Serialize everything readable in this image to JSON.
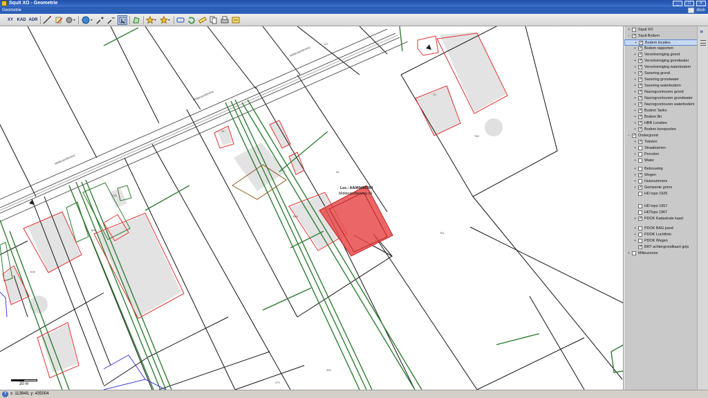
{
  "window": {
    "title": "Squit XO - Geometrie"
  },
  "menu": {
    "items": [
      "Geometrie"
    ],
    "dock_label": "dock"
  },
  "toolbar": {
    "xy_label": "XY",
    "kad_label": "KAD",
    "adr_label": "ADR"
  },
  "map": {
    "labels": {
      "street_top": "Middenpolderweg",
      "street_mid": "Middenpolderweg",
      "street_low": "Middenpolderweg",
      "p147": "147",
      "p760": "760",
      "p761": "761",
      "p805": "805",
      "p715": "715",
      "p618": "618",
      "p889": "889",
      "p400": "400",
      "p479": "479",
      "p70": "70",
      "p10": "10",
      "p25": "25"
    },
    "marker": {
      "loc": "Loc.: AA069400264",
      "address": "Middenpolderweg 29"
    },
    "scale_label": "20 m"
  },
  "status": {
    "coords": "x: 113949, y: 435004"
  },
  "layers": [
    {
      "label": "Squit XO",
      "level": 0,
      "exp": "+",
      "check": false
    },
    {
      "label": "Squit Bodem",
      "level": 0,
      "exp": "−",
      "check": true
    },
    {
      "label": "Bodem locaties",
      "level": 1,
      "exp": "+",
      "check": true,
      "selected": true
    },
    {
      "label": "Bodem rapporten",
      "level": 1,
      "exp": "+",
      "check": true
    },
    {
      "label": "Verontreiniging grond",
      "level": 1,
      "exp": "+",
      "check": true
    },
    {
      "label": "Verontreiniging grondwater",
      "level": 1,
      "exp": "+",
      "check": true
    },
    {
      "label": "Verontreiniging waterbodem",
      "level": 1,
      "exp": "+",
      "check": true
    },
    {
      "label": "Sanering grond",
      "level": 1,
      "exp": "+",
      "check": true
    },
    {
      "label": "Sanering grondwater",
      "level": 1,
      "exp": "+",
      "check": true
    },
    {
      "label": "Sanering waterbodem",
      "level": 1,
      "exp": "+",
      "check": true
    },
    {
      "label": "Nazorgcontouren grond",
      "level": 1,
      "exp": "+",
      "check": true
    },
    {
      "label": "Nazorgcontouren grondwater",
      "level": 1,
      "exp": "+",
      "check": true
    },
    {
      "label": "Nazorgcontouren waterbodem",
      "level": 1,
      "exp": "+",
      "check": true
    },
    {
      "label": "Bodem Tanks",
      "level": 1,
      "exp": "+",
      "check": true
    },
    {
      "label": "Bodem Bri",
      "level": 1,
      "exp": "+",
      "check": true
    },
    {
      "label": "HBB Locaties",
      "level": 1,
      "exp": "+",
      "check": true
    },
    {
      "label": "Bodem boorpunten",
      "level": 1,
      "exp": "+",
      "check": true
    },
    {
      "label": "Ondergrond",
      "level": 0,
      "exp": "−",
      "check": true
    },
    {
      "label": "Teksten",
      "level": 1,
      "exp": "+",
      "check": true
    },
    {
      "label": "Straatnamen",
      "level": 1,
      "exp": "+",
      "check": false
    },
    {
      "label": "Percelen",
      "level": 1,
      "exp": "+",
      "check": false
    },
    {
      "label": "Water",
      "level": 1,
      "exp": "+",
      "check": false
    },
    {
      "label": "Bebouwing",
      "level": 1,
      "exp": "+",
      "check": false
    },
    {
      "label": "Wegen",
      "level": 1,
      "exp": "+",
      "check": true
    },
    {
      "label": "Huisnummers",
      "level": 1,
      "exp": "+",
      "check": false
    },
    {
      "label": "Gemeente grens",
      "level": 1,
      "exp": "+",
      "check": true
    },
    {
      "label": "HD topo 1925",
      "level": 1,
      "exp": "",
      "check": false
    },
    {
      "label": "HD topo 1957",
      "level": 1,
      "exp": "",
      "check": false
    },
    {
      "label": "HDTopo 1967",
      "level": 1,
      "exp": "",
      "check": false
    },
    {
      "label": "PDOK Kadastrale kaart",
      "level": 1,
      "exp": "+",
      "check": true
    },
    {
      "label": "PDOK BAG pand",
      "level": 1,
      "exp": "+",
      "check": false
    },
    {
      "label": "PDOK Luchtfoto",
      "level": 1,
      "exp": "+",
      "check": false
    },
    {
      "label": "PDOK Wegen",
      "level": 1,
      "exp": "+",
      "check": false
    },
    {
      "label": "BRT achtergrondkaart grijs",
      "level": 1,
      "exp": "",
      "check": true
    },
    {
      "label": "Milieuzones",
      "level": 0,
      "exp": "+",
      "check": false
    }
  ],
  "colors": {
    "selection": "#e84c4c",
    "contour_red": "#e03030",
    "parcel_green": "#2f7d32",
    "building_gray": "#e3e3e3"
  }
}
